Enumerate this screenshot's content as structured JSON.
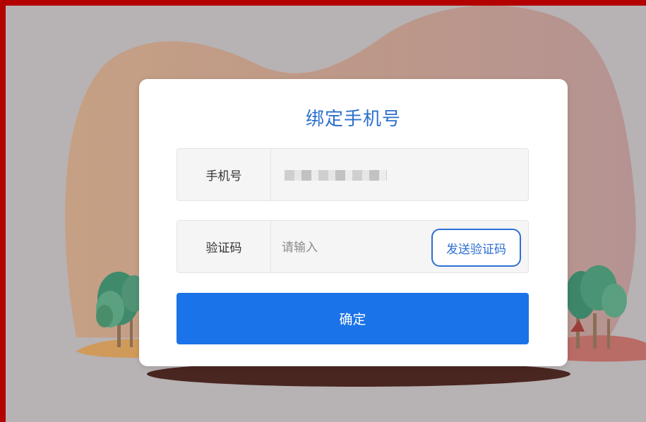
{
  "dialog": {
    "title": "绑定手机号",
    "phone_label": "手机号",
    "code_label": "验证码",
    "code_placeholder": "请输入",
    "send_code_label": "发送验证码",
    "confirm_label": "确定"
  },
  "colors": {
    "frame": "#b30000",
    "page_background": "#b7b2b4",
    "accent": "#1a73e8",
    "title": "#2b6fce"
  }
}
